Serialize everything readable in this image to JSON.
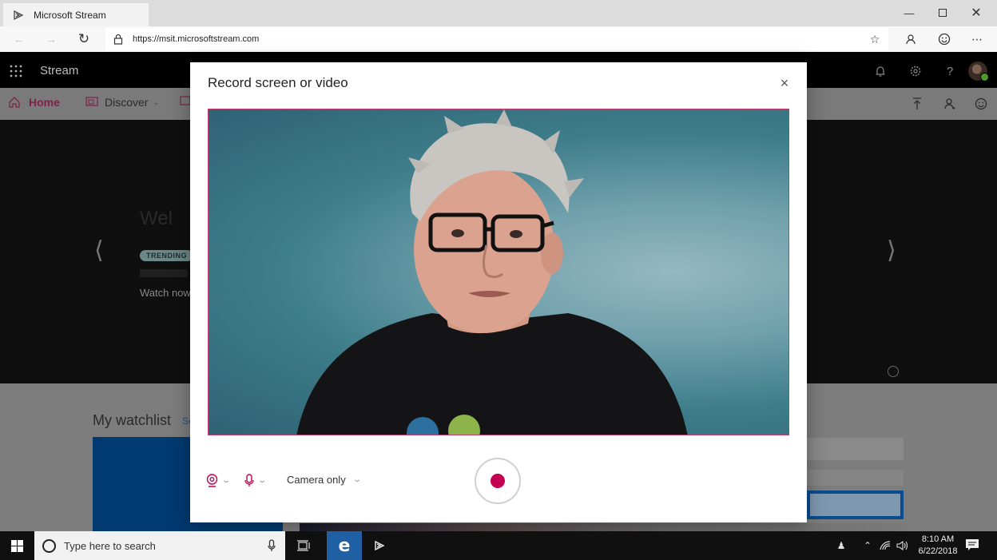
{
  "browser": {
    "tab_title": "Microsoft Stream",
    "url": "https://msit.microsoftstream.com",
    "window_controls": [
      "minimize",
      "maximize",
      "close"
    ],
    "toolbar_icons": [
      "favorite-star-icon",
      "profile-icon",
      "feedback-smiley-icon",
      "more-icon"
    ]
  },
  "app": {
    "name": "Stream",
    "header_icons": [
      "bell-icon",
      "gear-icon",
      "help-icon",
      "avatar"
    ],
    "help_glyph": "?",
    "nav": [
      {
        "label": "Home",
        "active": true
      },
      {
        "label": "Discover",
        "has_dropdown": true
      }
    ],
    "nav_right_icons": [
      "upload-icon",
      "user-add-icon",
      "feedback-icon"
    ],
    "hero": {
      "title_partial": "Wel",
      "badge": "TRENDING",
      "cta": "Watch now"
    },
    "watchlist": {
      "title": "My watchlist",
      "see_all_partial": "Se"
    },
    "colors": {
      "accent": "#c30052",
      "header_bg": "#000000",
      "badge_bg": "#6d8889"
    }
  },
  "modal": {
    "title": "Record screen or video",
    "close_glyph": "×",
    "preview_border_color": "#c4396a",
    "controls": {
      "camera_icon": "webcam-icon",
      "mic_icon": "microphone-icon",
      "source_selected": "Camera only",
      "record_color": "#c30052"
    }
  },
  "taskbar": {
    "search_placeholder": "Type here to search",
    "time": "8:10 AM",
    "date": "6/22/2018",
    "pinned": [
      "task-view-icon",
      "edge-icon",
      "stream-app-icon"
    ]
  }
}
